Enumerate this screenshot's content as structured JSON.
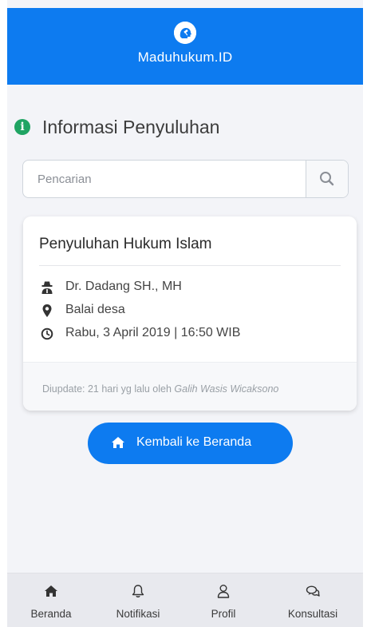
{
  "app": {
    "title": "Maduhukum.ID"
  },
  "page": {
    "title": "Informasi Penyuluhan"
  },
  "search": {
    "placeholder": "Pencarian",
    "value": ""
  },
  "card": {
    "title": "Penyuluhan Hukum Islam",
    "speaker": "Dr. Dadang SH., MH",
    "location": "Balai desa",
    "datetime": "Rabu, 3 April 2019 | 16:50 WIB",
    "updated_prefix": "Diupdate: 21 hari yg lalu oleh ",
    "updated_by": "Galih Wasis Wicaksono"
  },
  "home_button": {
    "label": "Kembali ke Beranda",
    "icon": "home-icon"
  },
  "bottom_nav": [
    {
      "label": "Beranda",
      "icon": "home-icon"
    },
    {
      "label": "Notifikasi",
      "icon": "bell-icon"
    },
    {
      "label": "Profil",
      "icon": "user-icon"
    },
    {
      "label": "Konsultasi",
      "icon": "chat-icon"
    }
  ],
  "colors": {
    "primary": "#0d7bf0",
    "info": "#1fa463",
    "background": "#f3f4f8"
  }
}
